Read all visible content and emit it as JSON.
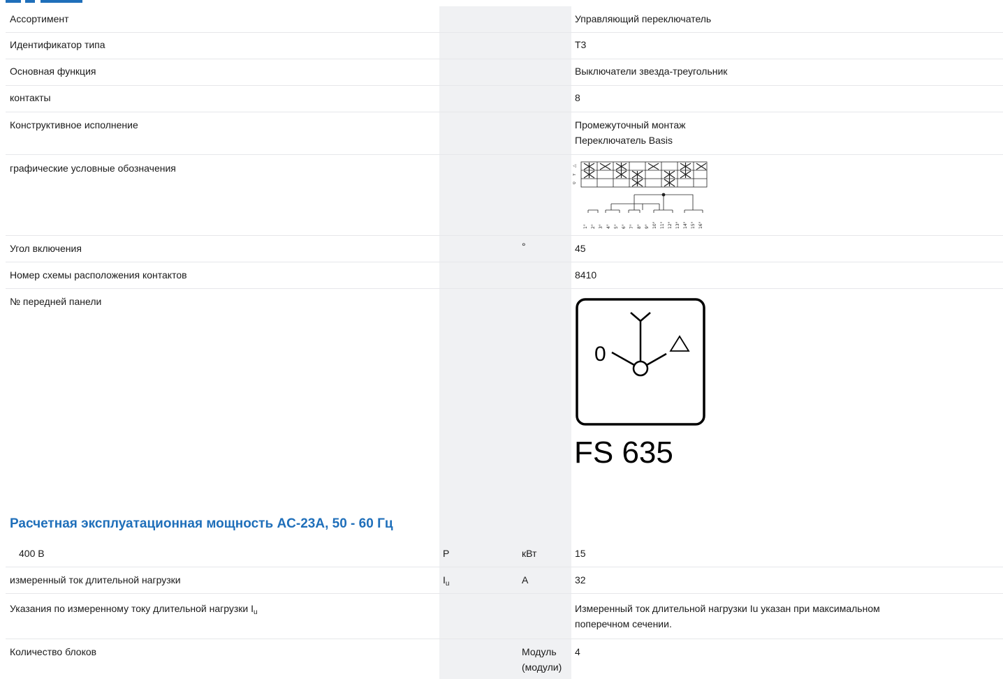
{
  "rows": {
    "assortment": {
      "name": "Ассортимент",
      "value": "Управляющий переключатель"
    },
    "type_id": {
      "name": "Идентификатор типа",
      "value": "T3"
    },
    "main_function": {
      "name": "Основная функция",
      "value": "Выключатели звезда-треугольник"
    },
    "contacts": {
      "name": "контакты",
      "value": "8"
    },
    "design": {
      "name": "Конструктивное исполнение",
      "value_line1": "Промежуточный монтаж",
      "value_line2": "Переключатель Basis"
    },
    "graphic_symbols": {
      "name": "графические условные обозначения"
    },
    "switch_angle": {
      "name": "Угол включения",
      "unit": "°",
      "value": "45"
    },
    "contact_scheme": {
      "name": "Номер схемы расположения контактов",
      "value": "8410"
    },
    "front_panel": {
      "name": "№ передней панели",
      "panel_label": "FS 635",
      "dial_zero": "0"
    }
  },
  "section": {
    "title": "Расчетная эксплуатационная мощность AC-23A, 50 - 60 Гц"
  },
  "rows2": {
    "v400": {
      "name": "400 В",
      "symbol": "P",
      "unit": "кВт",
      "value": "15"
    },
    "rated_current": {
      "name": "измеренный ток длительной нагрузки",
      "symbol_main": "I",
      "symbol_sub": "u",
      "unit": "A",
      "value": "32"
    },
    "current_notes": {
      "name_main": "Указания по измеренному току длительной нагрузки I",
      "name_sub": "u",
      "value_line1": "Измеренный ток длительной нагрузки Iu указан при максимальном",
      "value_line2": "поперечном сечении."
    },
    "blocks": {
      "name": "Количество блоков",
      "unit_line1": "Модуль",
      "unit_line2": "(модули)",
      "value": "4"
    }
  },
  "diagram": {
    "position_labels": [
      "0",
      "Y",
      "△"
    ],
    "terminal_numbers": [
      "1",
      "2",
      "3",
      "4",
      "5",
      "6",
      "7",
      "8",
      "9",
      "10",
      "11",
      "12",
      "13",
      "14",
      "15",
      "16"
    ]
  },
  "colors": {
    "accent": "#1f6fba",
    "gray_column": "#f0f1f3",
    "divider": "#e6e7ea"
  }
}
